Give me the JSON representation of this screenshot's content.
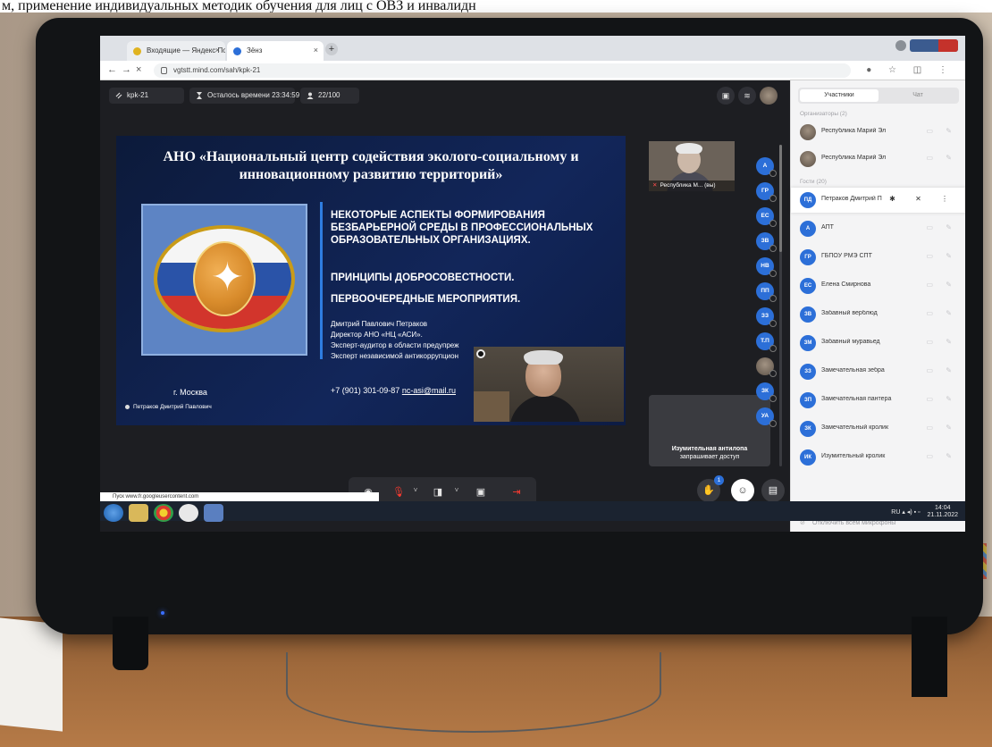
{
  "caption": "м, применение индивидуальных методик обучения для лиц с ОВЗ и инвалидн",
  "browser": {
    "tabs": [
      {
        "label": "Входящие — Яндекс Почта",
        "active": false
      },
      {
        "label": "Зёнз",
        "active": true
      }
    ],
    "url": "vgtstt.mind.com/sah/kpk-21"
  },
  "conference": {
    "room_label": "kpk-21",
    "timer_label": "Осталось времени",
    "timer_value": "23:34:59",
    "participants_count": "22/100"
  },
  "slide": {
    "title": "АНО «Национальный центр содействия эколого-социальному и инновационному развитию территорий»",
    "heading": "НЕКОТОРЫЕ АСПЕКТЫ ФОРМИРОВАНИЯ БЕЗБАРЬЕРНОЙ СРЕДЫ В ПРОФЕССИОНАЛЬНЫХ ОБРАЗОВАТЕЛЬНЫХ ОРГАНИЗАЦИЯХ.",
    "sub1": "ПРИНЦИПЫ ДОБРОСОВЕСТНОСТИ.",
    "sub2": "ПЕРВООЧЕРЕДНЫЕ МЕРОПРИЯТИЯ.",
    "author_lines": [
      "Дмитрий Павлович Петраков",
      "Директор АНО «НЦ «АСИ».",
      "Эксперт-аудитор в области предупреж",
      "Эксперт независимой антикоррупцион"
    ],
    "phone": "+7 (901) 301-09-87",
    "email": "nc-asi@mail.ru",
    "city": "г. Москва",
    "presenter": "Петраков Дмитрий Павлович"
  },
  "video_tile_label": "Республика М...",
  "video_tile_suffix": "(вы)",
  "request": {
    "name": "Изумительная антилопа",
    "text": "запрашивает доступ"
  },
  "strip_avatars": [
    "А",
    "ГР",
    "ЕС",
    "ЗВ",
    "НВ",
    "ПП",
    "ЗЗ",
    "Т.П",
    "",
    "ЗК",
    "УА"
  ],
  "hands_badge": "1",
  "panel": {
    "tab_participants": "Участники",
    "tab_chat": "Чат",
    "section_organizers": "Организаторы (2)",
    "section_guests": "Гости (20)",
    "organizers": [
      {
        "initials": "",
        "name": "Республика Марий Эл"
      },
      {
        "initials": "",
        "name": "Республика Марий Эл"
      }
    ],
    "guests": [
      {
        "initials": "ПД",
        "name": "Петраков Дмитрий П"
      },
      {
        "initials": "А",
        "name": "АПТ"
      },
      {
        "initials": "ГР",
        "name": "ГБПОУ РМЭ СПТ"
      },
      {
        "initials": "ЕС",
        "name": "Елена Смирнова"
      },
      {
        "initials": "ЗВ",
        "name": "Забавный верблюд"
      },
      {
        "initials": "ЗМ",
        "name": "Забавный муравьед"
      },
      {
        "initials": "ЗЗ",
        "name": "Замечательная зебра"
      },
      {
        "initials": "ЗП",
        "name": "Замечательная пантера"
      },
      {
        "initials": "ЗК",
        "name": "Замечательный кролик"
      },
      {
        "initials": "ИК",
        "name": "Изумительный кролик"
      }
    ],
    "footer": "Отключить всем микрофоны"
  },
  "statusbar_url": "www.fr.googleusercontent.com",
  "statusbar_prefix": "Пуск",
  "tray": {
    "lang": "RU",
    "time": "14:04",
    "date": "21.11.2022"
  }
}
